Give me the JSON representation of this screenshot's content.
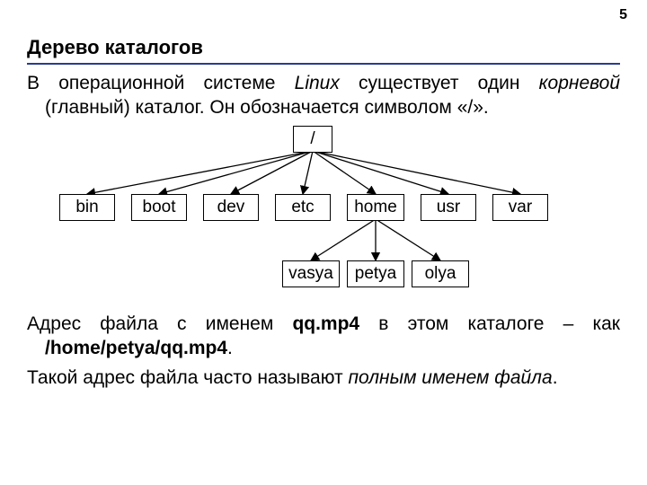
{
  "page_number": "5",
  "title": "Дерево каталогов",
  "para1_a": "В операционной системе ",
  "para1_b": "Linux",
  "para1_c": " существует один ",
  "para1_d": "корневой",
  "para1_e": " (главный) каталог. Он обозначается символом «/».",
  "para2_a": "Адрес файла с именем ",
  "para2_b": "qq.mp4",
  "para2_c": " в этом каталоге – как ",
  "para2_d": "/home/petya/qq.mp4",
  "para2_e": ".",
  "para3_a": "Такой адрес файла часто называют ",
  "para3_b": "полным именем файла",
  "para3_c": ".",
  "tree": {
    "root": "/",
    "level1": {
      "bin": "bin",
      "boot": "boot",
      "dev": "dev",
      "etc": "etc",
      "home": "home",
      "usr": "usr",
      "var": "var"
    },
    "level2": {
      "vasya": "vasya",
      "petya": "petya",
      "olya": "olya"
    }
  }
}
